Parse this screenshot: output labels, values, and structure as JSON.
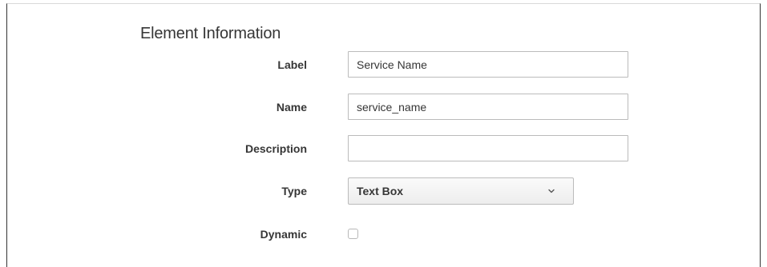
{
  "section": {
    "title": "Element Information"
  },
  "fields": {
    "label": {
      "label": "Label",
      "value": "Service Name"
    },
    "name": {
      "label": "Name",
      "value": "service_name"
    },
    "description": {
      "label": "Description",
      "value": ""
    },
    "type": {
      "label": "Type",
      "selected": "Text Box"
    },
    "dynamic": {
      "label": "Dynamic",
      "checked": false
    }
  },
  "icons": {
    "type_dropdown": "chevron-down-icon"
  }
}
